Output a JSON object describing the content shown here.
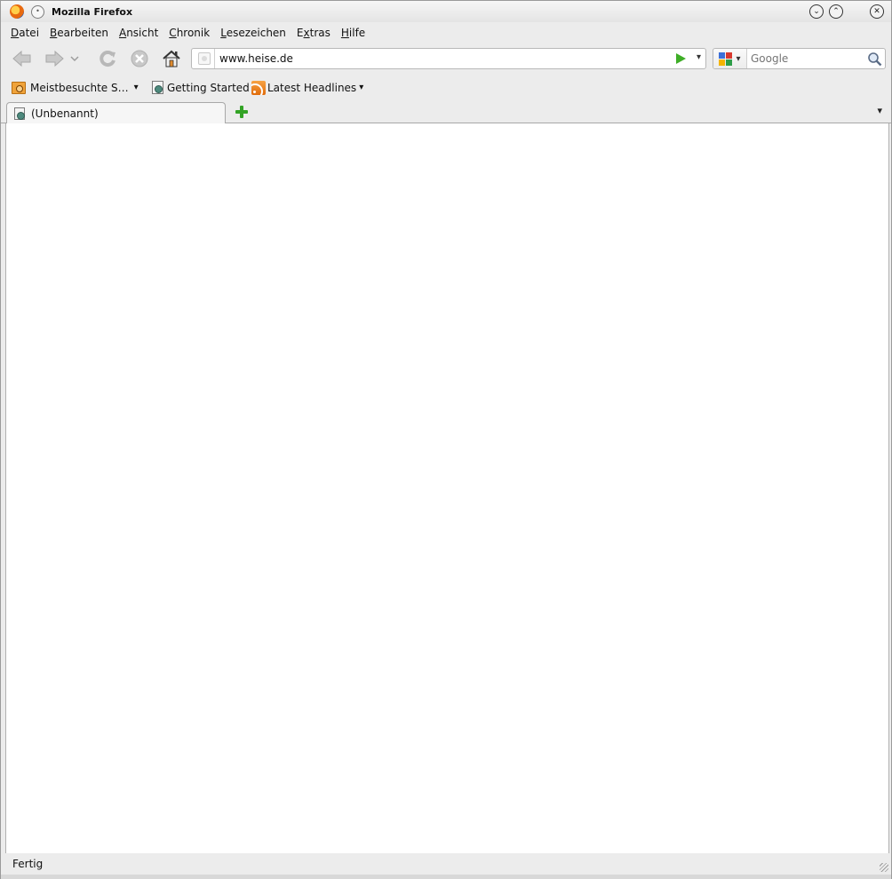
{
  "window": {
    "title": "Mozilla Firefox"
  },
  "menu": {
    "items": [
      {
        "accel": "D",
        "rest": "atei"
      },
      {
        "accel": "B",
        "rest": "earbeiten"
      },
      {
        "accel": "A",
        "rest": "nsicht"
      },
      {
        "accel": "C",
        "rest": "hronik"
      },
      {
        "accel": "L",
        "rest": "esezeichen"
      },
      {
        "pre": "E",
        "accel": "x",
        "rest": "tras"
      },
      {
        "accel": "H",
        "rest": "ilfe"
      }
    ]
  },
  "urlbar": {
    "value": "www.heise.de"
  },
  "search": {
    "engine": "google-icon",
    "placeholder": "Google"
  },
  "bookmarks": {
    "most_visited": "Meistbesuchte S…",
    "getting_started": "Getting Started",
    "latest_headlines": "Latest Headlines"
  },
  "tabs": [
    {
      "label": "(Unbenannt)"
    }
  ],
  "status": {
    "text": "Fertig"
  },
  "colors": {
    "go_arrow": "#3fae27",
    "new_tab_plus": "#33a325",
    "rss": "#e06b0a"
  }
}
